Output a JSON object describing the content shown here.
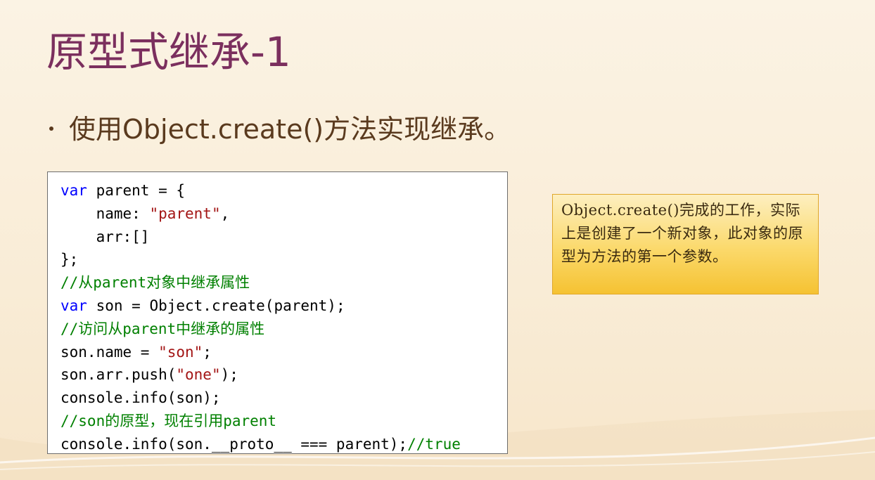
{
  "slide": {
    "title": "原型式继承-1",
    "bullet": "使用Object.create()方法实现继承。"
  },
  "code": {
    "lines": [
      [
        {
          "t": "var",
          "k": "kw"
        },
        {
          "t": " parent = {",
          "k": "plain"
        }
      ],
      [
        {
          "t": "    name: ",
          "k": "plain"
        },
        {
          "t": "\"parent\"",
          "k": "str"
        },
        {
          "t": ",",
          "k": "plain"
        }
      ],
      [
        {
          "t": "    arr:[]",
          "k": "plain"
        }
      ],
      [
        {
          "t": "};",
          "k": "plain"
        }
      ],
      [
        {
          "t": "//从parent对象中继承属性",
          "k": "cm"
        }
      ],
      [
        {
          "t": "var",
          "k": "kw"
        },
        {
          "t": " son = Object.create(parent);",
          "k": "plain"
        }
      ],
      [
        {
          "t": "//访问从parent中继承的属性",
          "k": "cm"
        }
      ],
      [
        {
          "t": "son.name = ",
          "k": "plain"
        },
        {
          "t": "\"son\"",
          "k": "str"
        },
        {
          "t": ";",
          "k": "plain"
        }
      ],
      [
        {
          "t": "son.arr.push(",
          "k": "plain"
        },
        {
          "t": "\"one\"",
          "k": "str"
        },
        {
          "t": ");",
          "k": "plain"
        }
      ],
      [
        {
          "t": "console.info(son);",
          "k": "plain"
        }
      ],
      [
        {
          "t": "//son的原型，现在引用parent",
          "k": "cm"
        }
      ],
      [
        {
          "t": "console.info(son.__proto__ === parent);",
          "k": "plain"
        },
        {
          "t": "//true",
          "k": "cm"
        }
      ]
    ]
  },
  "note": {
    "text": "Object.create()完成的工作，实际上是创建了一个新对象，此对象的原型为方法的第一个参数。"
  },
  "colors": {
    "title": "#7b2f5e",
    "bullet": "#5a3a1e",
    "keyword": "#0000ff",
    "string": "#a31515",
    "comment": "#008000",
    "note_bg": "#fbd96b",
    "note_border": "#e0a72a"
  }
}
